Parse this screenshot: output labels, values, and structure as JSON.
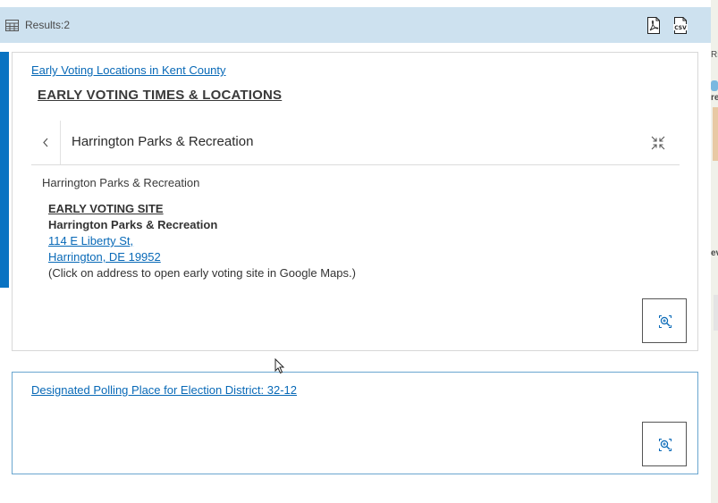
{
  "results": {
    "label": "Results:2",
    "table_icon": "table-icon",
    "export_pdf_icon": "pdf-export-icon",
    "export_csv_icon": "csv-export-icon"
  },
  "card1": {
    "layer_link": "Early Voting Locations in Kent County",
    "heading": "EARLY VOTING TIMES & LOCATIONS",
    "popup_title": "Harrington Parks & Recreation",
    "feature_title": "Harrington Parks & Recreation",
    "site": {
      "heading": "EARLY VOTING SITE",
      "name": "Harrington Parks & Recreation",
      "address_line1": "114 E Liberty St,",
      "address_line2": "Harrington, DE  19952",
      "note": "(Click on address to open early voting site in Google Maps.)"
    },
    "back_icon": "chevron-left-icon",
    "collapse_icon": "collapse-icon",
    "zoom_icon": "zoom-to-icon"
  },
  "card2": {
    "layer_link": "Designated Polling Place for Election District: 32-12",
    "zoom_icon": "zoom-to-icon"
  },
  "map_edge": {
    "labels": [
      "Ri",
      "re",
      "ev"
    ]
  },
  "colors": {
    "results_bar": "#cde1ef",
    "link": "#0869b7",
    "selected_accent": "#0a73c2",
    "card2_border": "#6aa6cf"
  }
}
